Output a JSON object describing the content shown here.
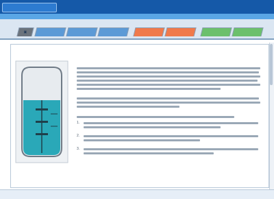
{
  "header": {
    "logo": "",
    "nav": [
      "",
      "",
      "",
      ""
    ],
    "subnav": [
      "",
      "",
      ""
    ]
  },
  "tabs": [
    {
      "label": "",
      "color": "#5c6670"
    },
    {
      "label": "",
      "color": "#4f8fd0"
    },
    {
      "label": "",
      "color": "#4f8fd0"
    },
    {
      "label": "",
      "color": "#4f8fd0"
    },
    {
      "label": "",
      "color": "#e86a3c"
    },
    {
      "label": "",
      "color": "#e86a3c"
    },
    {
      "label": "",
      "color": "#5cb85c"
    },
    {
      "label": "",
      "color": "#5cb85c"
    }
  ],
  "sidebar": {
    "label": ""
  },
  "content": {
    "heading_1": "",
    "heading_2": "",
    "list_numbers": [
      "1.",
      "2.",
      "3."
    ]
  },
  "colors": {
    "header_blue": "#1559a8",
    "subbar_blue": "#5aa6e5",
    "liquid": "#2aa8b8",
    "accent_orange": "#d45a1a"
  },
  "icons": {
    "tab_home": "book-icon"
  }
}
